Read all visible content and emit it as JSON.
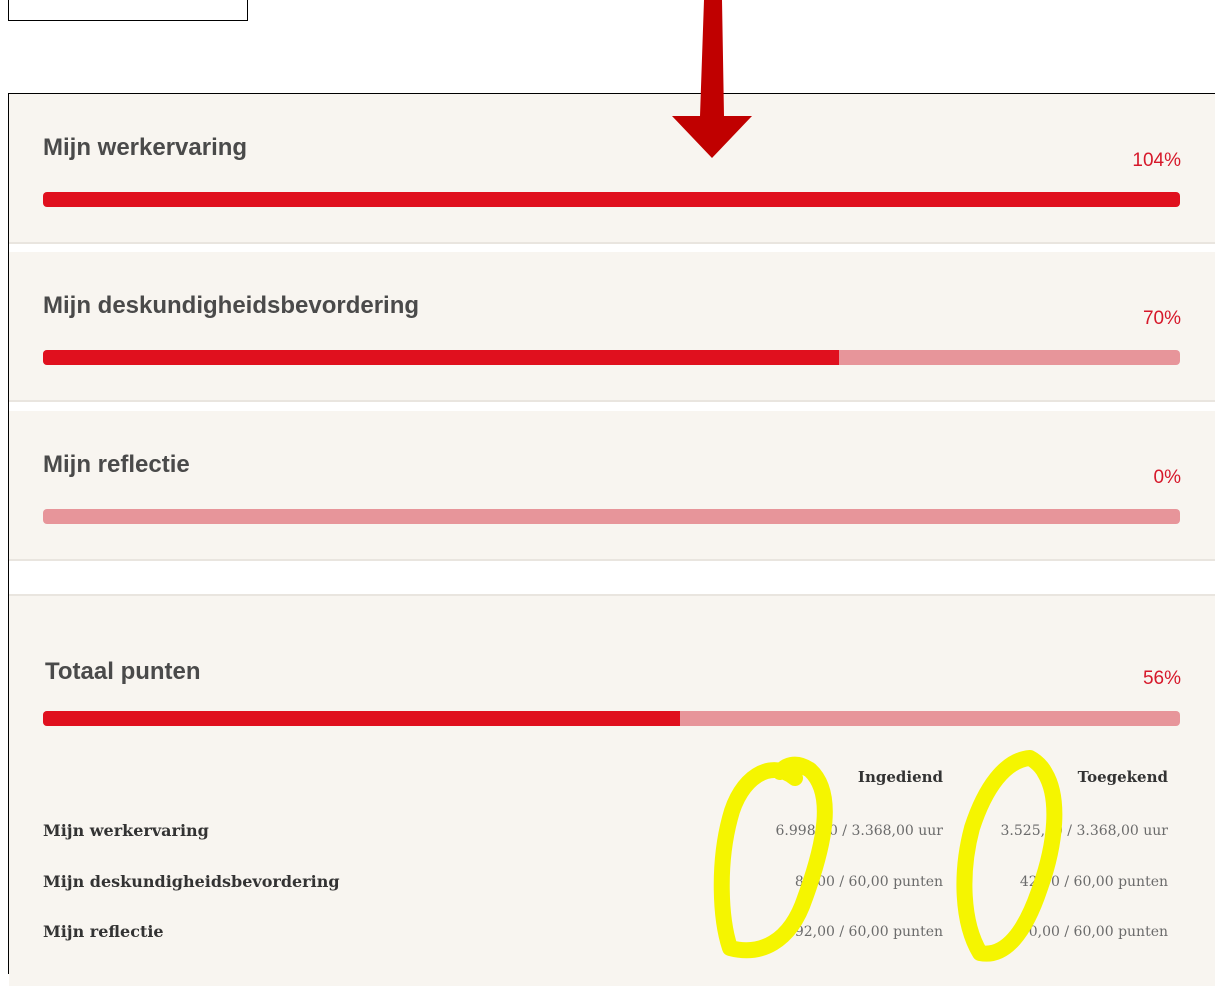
{
  "sections": [
    {
      "title": "Mijn werkervaring",
      "percent_label": "104%",
      "progress": 1.0
    },
    {
      "title": "Mijn deskundigheidsbevordering",
      "percent_label": "70%",
      "progress": 0.7
    },
    {
      "title": "Mijn reflectie",
      "percent_label": "0%",
      "progress": 0.0
    }
  ],
  "total": {
    "title": "Totaal punten",
    "percent_label": "56%",
    "progress": 0.56,
    "columns": {
      "submitted": "Ingediend",
      "awarded": "Toegekend"
    },
    "rows": [
      {
        "label": "Mijn werkervaring",
        "submitted": "6.998,00 / 3.368,00 uur",
        "awarded": "3.525,00 / 3.368,00 uur"
      },
      {
        "label": "Mijn deskundigheidsbevordering",
        "submitted": "82,00 / 60,00 punten",
        "awarded": "42,00 / 60,00 punten"
      },
      {
        "label": "Mijn reflectie",
        "submitted": "592,00 / 60,00 punten",
        "awarded": "0,00 / 60,00 punten"
      }
    ]
  },
  "colors": {
    "accent_red": "#e0101e",
    "track_pink": "#e7959a",
    "arrow_red": "#c00000",
    "highlighter_yellow": "#f5f500"
  },
  "icons": {
    "annotation_arrow": "down-arrow-icon",
    "annotation_marker": "highlighter-circle-icon"
  }
}
